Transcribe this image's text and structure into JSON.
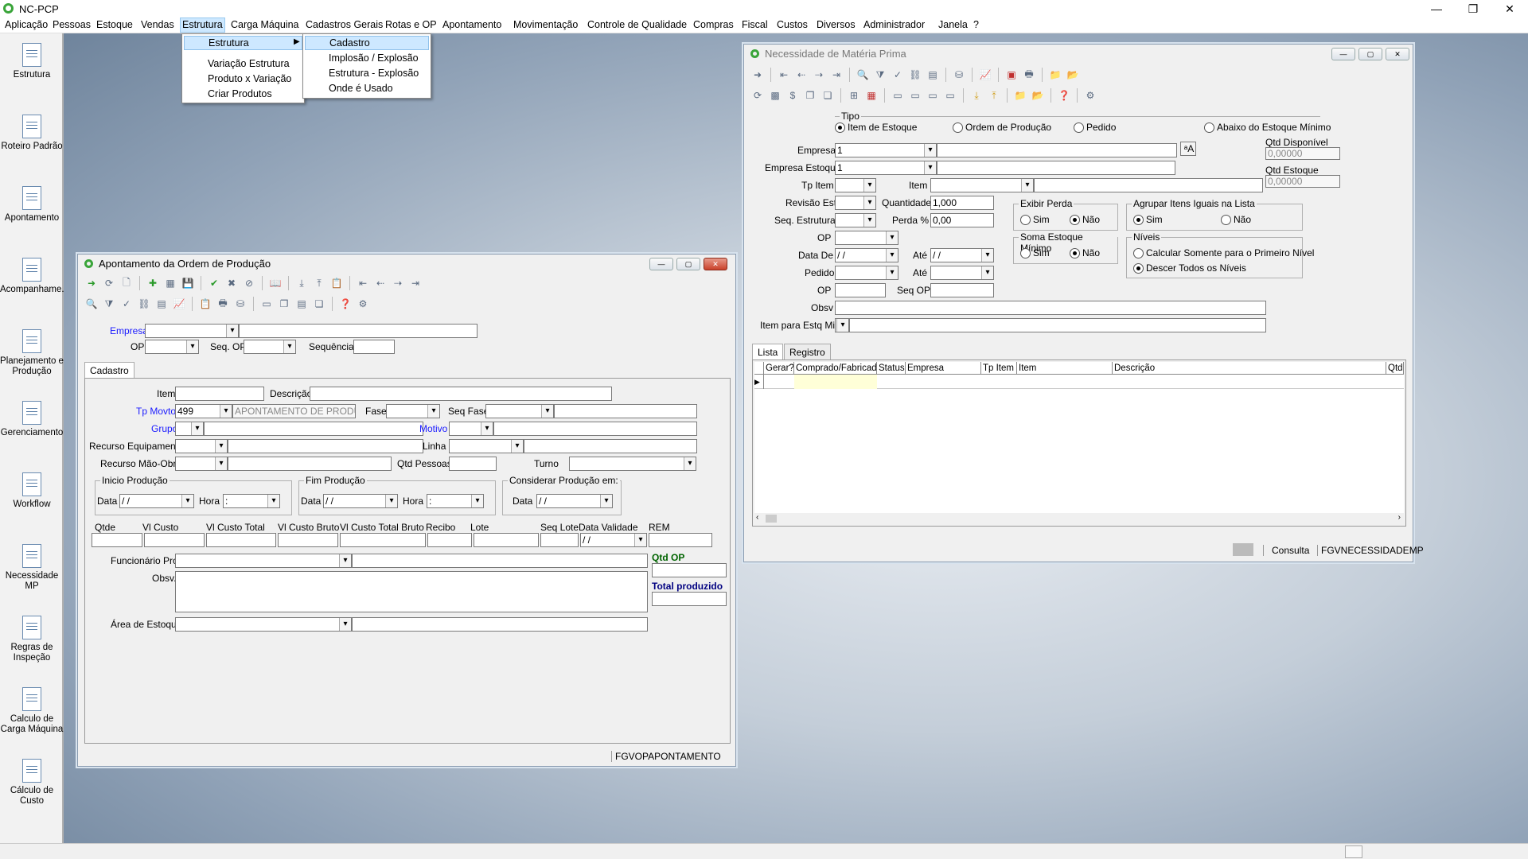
{
  "app": {
    "title": "NC-PCP"
  },
  "menu": [
    "Aplicação",
    "Pessoas",
    "Estoque",
    "Vendas",
    "Estrutura",
    "Carga Máquina",
    "Cadastros Gerais",
    "Rotas e OP",
    "Apontamento",
    "Movimentação",
    "Controle de Qualidade",
    "Compras",
    "Fiscal",
    "Custos",
    "Diversos",
    "Administrador",
    "Janela",
    "?"
  ],
  "submenu1": [
    "Estrutura",
    "Variação Estrutura",
    "Produto x Variação",
    "Criar Produtos"
  ],
  "submenu2": [
    "Cadastro",
    "Implosão / Explosão",
    "Estrutura - Explosão",
    "Onde é Usado"
  ],
  "sidebar": [
    "Estrutura",
    "Roteiro Padrão",
    "Apontamento",
    "Acompanhame..",
    "Planejamento e Produção",
    "Gerenciamento",
    "Workflow",
    "Necessidade MP",
    "Regras de Inspeção",
    "Calculo de Carga Máquina",
    "Cálculo de Custo"
  ],
  "apont": {
    "title": "Apontamento da Ordem de Produção",
    "empresa": "Empresa",
    "op": "OP",
    "seq_op": "Seq. OP",
    "sequencia": "Sequência",
    "tab": "Cadastro",
    "item": "Item",
    "descricao": "Descrição",
    "tp_movto": "Tp Movto",
    "tp_movto_val": "499",
    "tp_movto_desc": "APONTAMENTO DE PRODUC",
    "fase": "Fase",
    "seq_fase": "Seq Fase",
    "grupo": "Grupo",
    "motivo": "Motivo",
    "recurso_eq": "Recurso Equipamento",
    "linha": "Linha",
    "recurso_mo": "Recurso Mão-Obra",
    "qtd_pessoas": "Qtd Pessoas",
    "turno": "Turno",
    "inicio": "Inicio Produção",
    "fim": "Fim Produção",
    "considerar": "Considerar Produção em:",
    "data": "Data",
    "hora": "Hora",
    "date_ph": " / /",
    "hora_ph": " :",
    "cols": [
      "Qtde",
      "Vl Custo",
      "Vl Custo Total",
      "Vl Custo Bruto",
      "Vl Custo Total Bruto",
      "Recibo",
      "Lote",
      "Seq Lote",
      "Data Validade",
      "REM"
    ],
    "funcionario": "Funcionário Prod.",
    "obsv": "Obsv.",
    "area": "Área de Estoque",
    "qtd_op": "Qtd OP",
    "total_prod": "Total produzido",
    "status": "FGVOPAPONTAMENTO"
  },
  "nec": {
    "title": "Necessidade de Matéria Prima",
    "tipo": "Tipo",
    "tipo_opts": [
      "Item de Estoque",
      "Ordem de Produção",
      "Pedido",
      "Abaixo do Estoque Mínimo"
    ],
    "empresa": "Empresa",
    "empresa_val": "1",
    "empresa_est": "Empresa Estoque",
    "empresa_est_val": "1",
    "qtd_disp": "Qtd Disponível",
    "qtd_disp_val": "0,00000",
    "qtd_est": "Qtd Estoque",
    "qtd_est_val": "0,00000",
    "tp_item": "Tp Item",
    "item": "Item",
    "revisao": "Revisão Est",
    "quantidade": "Quantidade",
    "quantidade_val": "1,000",
    "seq_estrutura": "Seq. Estrutura",
    "perda": "Perda %",
    "perda_val": "0,00",
    "op": "OP",
    "data_de": "Data De",
    "ate": "Até",
    "pedido": "Pedido",
    "seq_op": "Seq OP",
    "obsv": "Obsv",
    "item_estq": "Item para Estq Min",
    "exibir_perda": "Exibir Perda",
    "soma_est": "Soma Estoque Mínimo",
    "agrupar": "Agrupar Itens Iguais na Lista",
    "niveis": "Níveis",
    "sim": "Sim",
    "nao": "Não",
    "nivel1": "Calcular Somente para o Primeiro Nível",
    "nivel2": "Descer Todos os Níveis",
    "tabs": [
      "Lista",
      "Registro"
    ],
    "cols": [
      "Gerar?",
      "Comprado/Fabricado",
      "Status",
      "Empresa",
      "Tp Item",
      "Item",
      "Descrição",
      "Qtd.F"
    ],
    "status_mode": "Consulta",
    "status_name": "FGVNECESSIDADEMP",
    "date_ph": " / /"
  }
}
